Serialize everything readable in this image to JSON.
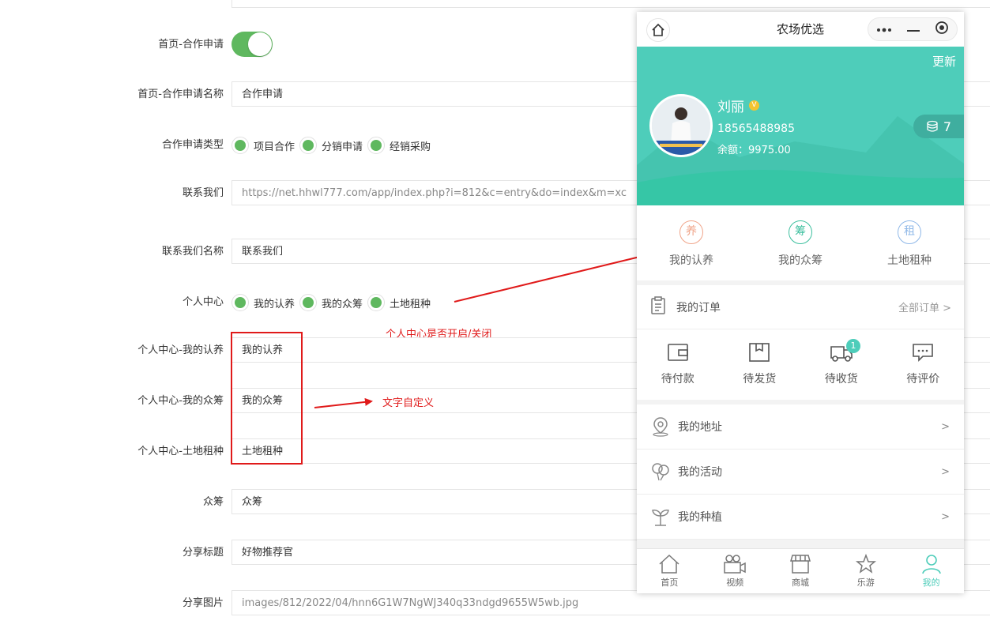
{
  "form": {
    "toggle_label": "首页-合作申请",
    "coop_name_label": "首页-合作申请名称",
    "coop_name_value": "合作申请",
    "coop_type_label": "合作申请类型",
    "coop_types": [
      "项目合作",
      "分销申请",
      "经销采购"
    ],
    "contact_label": "联系我们",
    "contact_value": "https://net.hhwl777.com/app/index.php?i=812&c=entry&do=index&m=xc",
    "contact_name_label": "联系我们名称",
    "contact_name_value": "联系我们",
    "personal_label": "个人中心",
    "personal_options": [
      "我的认养",
      "我的众筹",
      "土地租种"
    ],
    "adopt_label": "个人中心-我的认养",
    "adopt_value": "我的认养",
    "crowd_label": "个人中心-我的众筹",
    "crowd_value": "我的众筹",
    "land_label": "个人中心-土地租种",
    "land_value": "土地租种",
    "zc_label": "众筹",
    "zc_value": "众筹",
    "share_title_label": "分享标题",
    "share_title_value": "好物推荐官",
    "share_img_label": "分享图片",
    "share_img_value": "images/812/2022/04/hnn6G1W7NgWJ340q33ndgd9655W5wb.jpg"
  },
  "annotations": {
    "toggle_note": "个人中心是否开启/关闭",
    "text_note": "文字自定义"
  },
  "phone": {
    "title": "农场优选",
    "update": "更新",
    "user_name": "刘丽",
    "vip": "V",
    "user_phone": "18565488985",
    "balance": "余额：9975.00",
    "coins": "7",
    "quick": [
      {
        "char": "养",
        "label": "我的认养",
        "color": "#f0a58a"
      },
      {
        "char": "筹",
        "label": "我的众筹",
        "color": "#3cbf9e"
      },
      {
        "char": "租",
        "label": "土地租种",
        "color": "#8fb8e8"
      }
    ],
    "orders_title": "我的订单",
    "orders_all": "全部订单 >",
    "order_stats": [
      "待付款",
      "待发货",
      "待收货",
      "待评价"
    ],
    "order_badge": "1",
    "menu": [
      {
        "label": "我的地址",
        "chev": ">"
      },
      {
        "label": "我的活动",
        "chev": ">"
      },
      {
        "label": "我的种植",
        "chev": ">"
      }
    ],
    "tabs": [
      "首页",
      "视频",
      "商城",
      "乐游",
      "我的"
    ]
  },
  "colors": {
    "accent": "#4ecdba",
    "toggle": "#5fb85f",
    "annotation": "#e01a1a"
  }
}
